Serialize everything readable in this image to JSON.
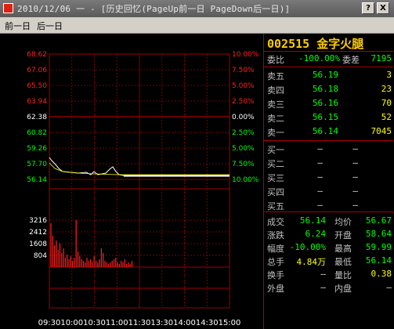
{
  "window": {
    "title": "2010/12/06  一  - [历史回忆(PageUp前一日 PageDown后一日)]",
    "help_label": "?",
    "close_label": "X"
  },
  "menu": {
    "prev_day": "前一日",
    "next_day": "后一日"
  },
  "chart": {
    "price_labels": [
      "68.62",
      "67.06",
      "65.50",
      "63.94",
      "62.38",
      "60.82",
      "59.26",
      "57.70",
      "56.14"
    ],
    "pct_labels": [
      "10.00%",
      "7.50%",
      "5.00%",
      "2.50%",
      "0.00%",
      "2.50%",
      "5.00%",
      "7.50%",
      "10.00%"
    ],
    "vol_labels": [
      "3216",
      "2412",
      "1608",
      "804"
    ],
    "time_labels": [
      "09:30",
      "10:00",
      "10:30",
      "11:00",
      "11:30",
      "13:30",
      "14:00",
      "14:30",
      "15:00"
    ],
    "colors": {
      "up": "#ff2020",
      "down": "#00ff00",
      "neutral": "#ffffff",
      "grid": "#a00000",
      "line": "#ffffff",
      "avg": "#ffff00"
    }
  },
  "quote": {
    "code": "002515",
    "name": "金字火腿",
    "weibi_label": "委比",
    "weibi_value": "-100.00%",
    "weicha_label": "委差",
    "weicha_value": "7195",
    "sell": [
      {
        "label": "卖五",
        "price": "56.19",
        "vol": "3"
      },
      {
        "label": "卖四",
        "price": "56.18",
        "vol": "23"
      },
      {
        "label": "卖三",
        "price": "56.16",
        "vol": "70"
      },
      {
        "label": "卖二",
        "price": "56.15",
        "vol": "52"
      },
      {
        "label": "卖一",
        "price": "56.14",
        "vol": "7045"
      }
    ],
    "buy": [
      {
        "label": "买一",
        "price": "—",
        "vol": "—"
      },
      {
        "label": "买二",
        "price": "—",
        "vol": "—"
      },
      {
        "label": "买三",
        "price": "—",
        "vol": "—"
      },
      {
        "label": "买四",
        "price": "—",
        "vol": "—"
      },
      {
        "label": "买五",
        "price": "—",
        "vol": "—"
      }
    ],
    "stats": [
      {
        "l1": "成交",
        "v1": "56.14",
        "c1": "g",
        "l2": "均价",
        "v2": "56.67",
        "c2": "g"
      },
      {
        "l1": "涨跌",
        "v1": "6.24",
        "c1": "g",
        "l2": "开盘",
        "v2": "58.64",
        "c2": "g"
      },
      {
        "l1": "幅度",
        "v1": "-10.00%",
        "c1": "g",
        "l2": "最高",
        "v2": "59.99",
        "c2": "g"
      },
      {
        "l1": "总手",
        "v1": "4.84万",
        "c1": "y",
        "l2": "最低",
        "v2": "56.14",
        "c2": "g"
      },
      {
        "l1": "换手",
        "v1": "—",
        "c1": "w",
        "l2": "量比",
        "v2": "0.38",
        "c2": "y"
      },
      {
        "l1": "外盘",
        "v1": "—",
        "c1": "w",
        "l2": "内盘",
        "v2": "—",
        "c2": "w"
      }
    ]
  }
}
